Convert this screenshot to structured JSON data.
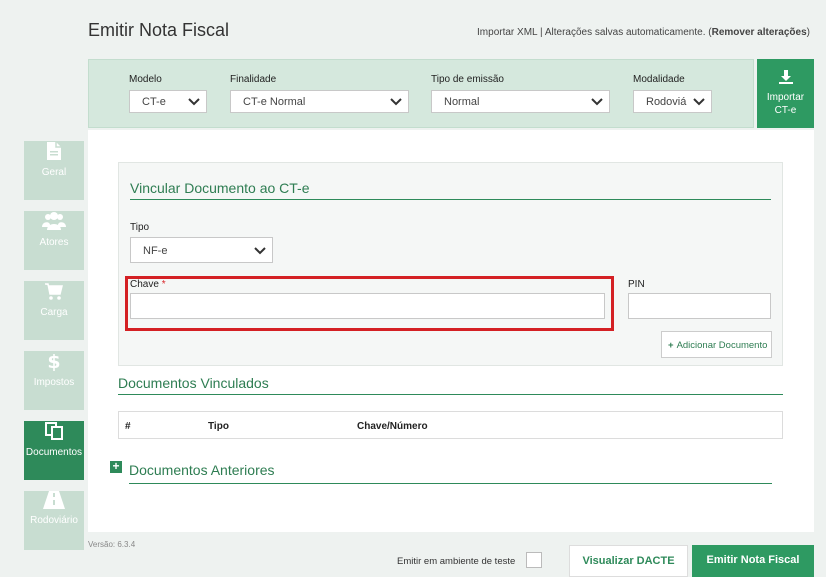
{
  "header": {
    "title": "Emitir Nota Fiscal",
    "import_xml": "Importar XML",
    "separator": " | ",
    "autosave": "Alterações salvas automaticamente. (",
    "remove_changes": "Remover alterações",
    "close_paren": ")"
  },
  "config": {
    "modelo_label": "Modelo",
    "modelo_value": "CT-e",
    "finalidade_label": "Finalidade",
    "finalidade_value": "CT-e Normal",
    "tipo_emissao_label": "Tipo de emissão",
    "tipo_emissao_value": "Normal",
    "modalidade_label": "Modalidade",
    "modalidade_value": "Rodoviá"
  },
  "import_button": {
    "line1": "Importar",
    "line2": "CT-e",
    "icon": "download-icon"
  },
  "sidebar": {
    "items": [
      {
        "label": "Geral",
        "icon": "document-icon",
        "active": false
      },
      {
        "label": "Atores",
        "icon": "users-icon",
        "active": false
      },
      {
        "label": "Carga",
        "icon": "cart-icon",
        "active": false
      },
      {
        "label": "Impostos",
        "icon": "dollar-icon",
        "active": false
      },
      {
        "label": "Documentos",
        "icon": "documents-icon",
        "active": true
      },
      {
        "label": "Rodoviário",
        "icon": "road-icon",
        "active": false
      }
    ]
  },
  "vincular": {
    "title": "Vincular Documento ao CT-e",
    "tipo_label": "Tipo",
    "tipo_value": "NF-e",
    "chave_label": "Chave",
    "required_mark": "*",
    "chave_value": "",
    "pin_label": "PIN",
    "pin_value": "",
    "add_button": "Adicionar Documento"
  },
  "vinculados": {
    "title": "Documentos Vinculados",
    "columns": [
      "#",
      "Tipo",
      "Chave/Número"
    ]
  },
  "anteriores": {
    "title": "Documentos Anteriores"
  },
  "footer": {
    "version": "Versão: 6.3.4",
    "test_env_label": "Emitir em ambiente de teste",
    "dacte_button": "Visualizar DACTE",
    "emit_button": "Emitir Nota Fiscal"
  },
  "colors": {
    "accent": "#2e9a62",
    "sidebar_active": "#2e8a5a",
    "sidebar_inactive": "#c8ddd1",
    "highlight": "#d42024"
  }
}
